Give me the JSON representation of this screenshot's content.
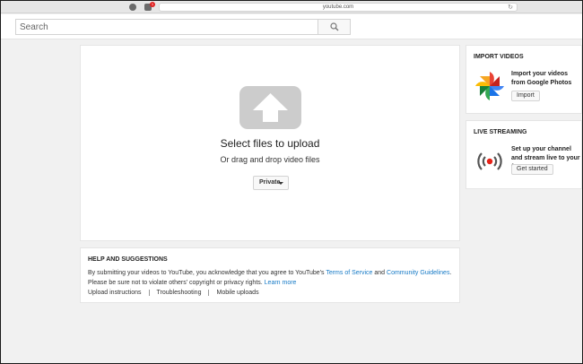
{
  "browser": {
    "url": "youtube.com",
    "notification_count": "1"
  },
  "search": {
    "placeholder": "Search"
  },
  "upload": {
    "title": "Select files to upload",
    "subtitle": "Or drag and drop video files",
    "privacy_value": "Private"
  },
  "help": {
    "title": "HELP AND SUGGESTIONS",
    "text_before": "By submitting your videos to YouTube, you acknowledge that you agree to YouTube's ",
    "terms_link": "Terms of Service",
    "text_and": " and ",
    "guidelines_link": "Community Guidelines",
    "text_after": ". Please be sure not to violate others' copyright or privacy rights. ",
    "learn_more_link": "Learn more",
    "links": [
      "Upload instructions",
      "Troubleshooting",
      "Mobile uploads"
    ]
  },
  "import_videos": {
    "title": "IMPORT VIDEOS",
    "description": "Import your videos from Google Photos",
    "button": "Import"
  },
  "live_streaming": {
    "title": "LIVE STREAMING",
    "description": "Set up your channel and stream live to your fans",
    "button": "Get started"
  },
  "colors": {
    "page_background": "#f1f1f1",
    "card_background": "#ffffff",
    "link": "#167ac6",
    "upload_icon": "#cccccc",
    "live_red": "#e62117"
  }
}
